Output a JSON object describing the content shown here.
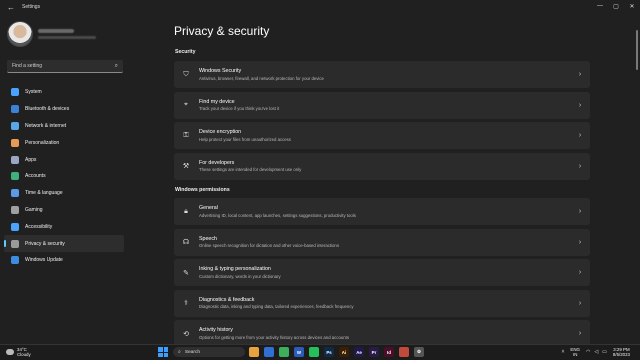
{
  "window": {
    "title": "Settings",
    "back_icon": "back-arrow-icon",
    "controls": [
      "—",
      "▢",
      "✕"
    ]
  },
  "sidebar": {
    "search_placeholder": "Find a setting",
    "items": [
      {
        "label": "System",
        "icon": "system-icon",
        "color": "#4aa3ff"
      },
      {
        "label": "Bluetooth & devices",
        "icon": "bluetooth-icon",
        "color": "#3b82d6"
      },
      {
        "label": "Network & internet",
        "icon": "wifi-icon",
        "color": "#58a6e8"
      },
      {
        "label": "Personalization",
        "icon": "brush-icon",
        "color": "#e59b55"
      },
      {
        "label": "Apps",
        "icon": "apps-icon",
        "color": "#9aa6c4"
      },
      {
        "label": "Accounts",
        "icon": "account-icon",
        "color": "#3fb07c"
      },
      {
        "label": "Time & language",
        "icon": "globe-clock-icon",
        "color": "#5a9be8"
      },
      {
        "label": "Gaming",
        "icon": "gamepad-icon",
        "color": "#a0a0a0"
      },
      {
        "label": "Accessibility",
        "icon": "accessibility-icon",
        "color": "#4aa3ff"
      },
      {
        "label": "Privacy & security",
        "icon": "shield-icon",
        "color": "#9a9a9a"
      },
      {
        "label": "Windows Update",
        "icon": "update-icon",
        "color": "#3d8ee0"
      }
    ],
    "active_index": 9
  },
  "main": {
    "title": "Privacy & security",
    "security_label": "Security",
    "security_items": [
      {
        "title": "Windows Security",
        "desc": "Antivirus, browser, firewall, and network protection for your device",
        "icon": "shield-icon"
      },
      {
        "title": "Find my device",
        "desc": "Track your device if you think you've lost it",
        "icon": "locate-icon"
      },
      {
        "title": "Device encryption",
        "desc": "Help protect your files from unauthorized access",
        "icon": "key-icon"
      },
      {
        "title": "For developers",
        "desc": "These settings are intended for development use only",
        "icon": "tools-icon"
      }
    ],
    "permissions_label": "Windows permissions",
    "permission_items": [
      {
        "title": "General",
        "desc": "Advertising ID, local content, app launches, settings suggestions, productivity tools",
        "icon": "lock-icon"
      },
      {
        "title": "Speech",
        "desc": "Online speech recognition for dictation and other voice-based interactions",
        "icon": "speech-icon"
      },
      {
        "title": "Inking & typing personalization",
        "desc": "Custom dictionary, words in your dictionary",
        "icon": "ink-icon"
      },
      {
        "title": "Diagnostics & feedback",
        "desc": "Diagnostic data, inking and typing data, tailored experiences, feedback frequency",
        "icon": "diagnostics-icon"
      },
      {
        "title": "Activity history",
        "desc": "Options for getting more from your activity history across devices and accounts",
        "icon": "history-icon"
      }
    ]
  },
  "taskbar": {
    "weather_temp": "34°C",
    "weather_desc": "Cloudy",
    "search_label": "Search",
    "apps": [
      {
        "name": "files-app",
        "label": "",
        "color": "#e8a33d"
      },
      {
        "name": "store-app",
        "label": "",
        "color": "#2f6fd6"
      },
      {
        "name": "chrome-app",
        "label": "",
        "color": "#3cae5c"
      },
      {
        "name": "word-app",
        "label": "W",
        "color": "#2b5cb8"
      },
      {
        "name": "whatsapp-app",
        "label": "",
        "color": "#25c05a"
      },
      {
        "name": "photoshop-app",
        "label": "Ps",
        "color": "#0d2a47"
      },
      {
        "name": "illustrator-app",
        "label": "Ai",
        "color": "#3d1f00"
      },
      {
        "name": "aftereffects-app",
        "label": "Ae",
        "color": "#1f1a4a"
      },
      {
        "name": "premiere-app",
        "label": "Pr",
        "color": "#2a1a4a"
      },
      {
        "name": "indesign-app",
        "label": "Id",
        "color": "#4a0d2a"
      },
      {
        "name": "misc-app",
        "label": "",
        "color": "#c24a3a"
      },
      {
        "name": "settings-app",
        "label": "⚙",
        "color": "#555555"
      }
    ],
    "lang_top": "ENG",
    "lang_bottom": "IN",
    "time": "3:29 PM",
    "date": "8/5/2023"
  }
}
